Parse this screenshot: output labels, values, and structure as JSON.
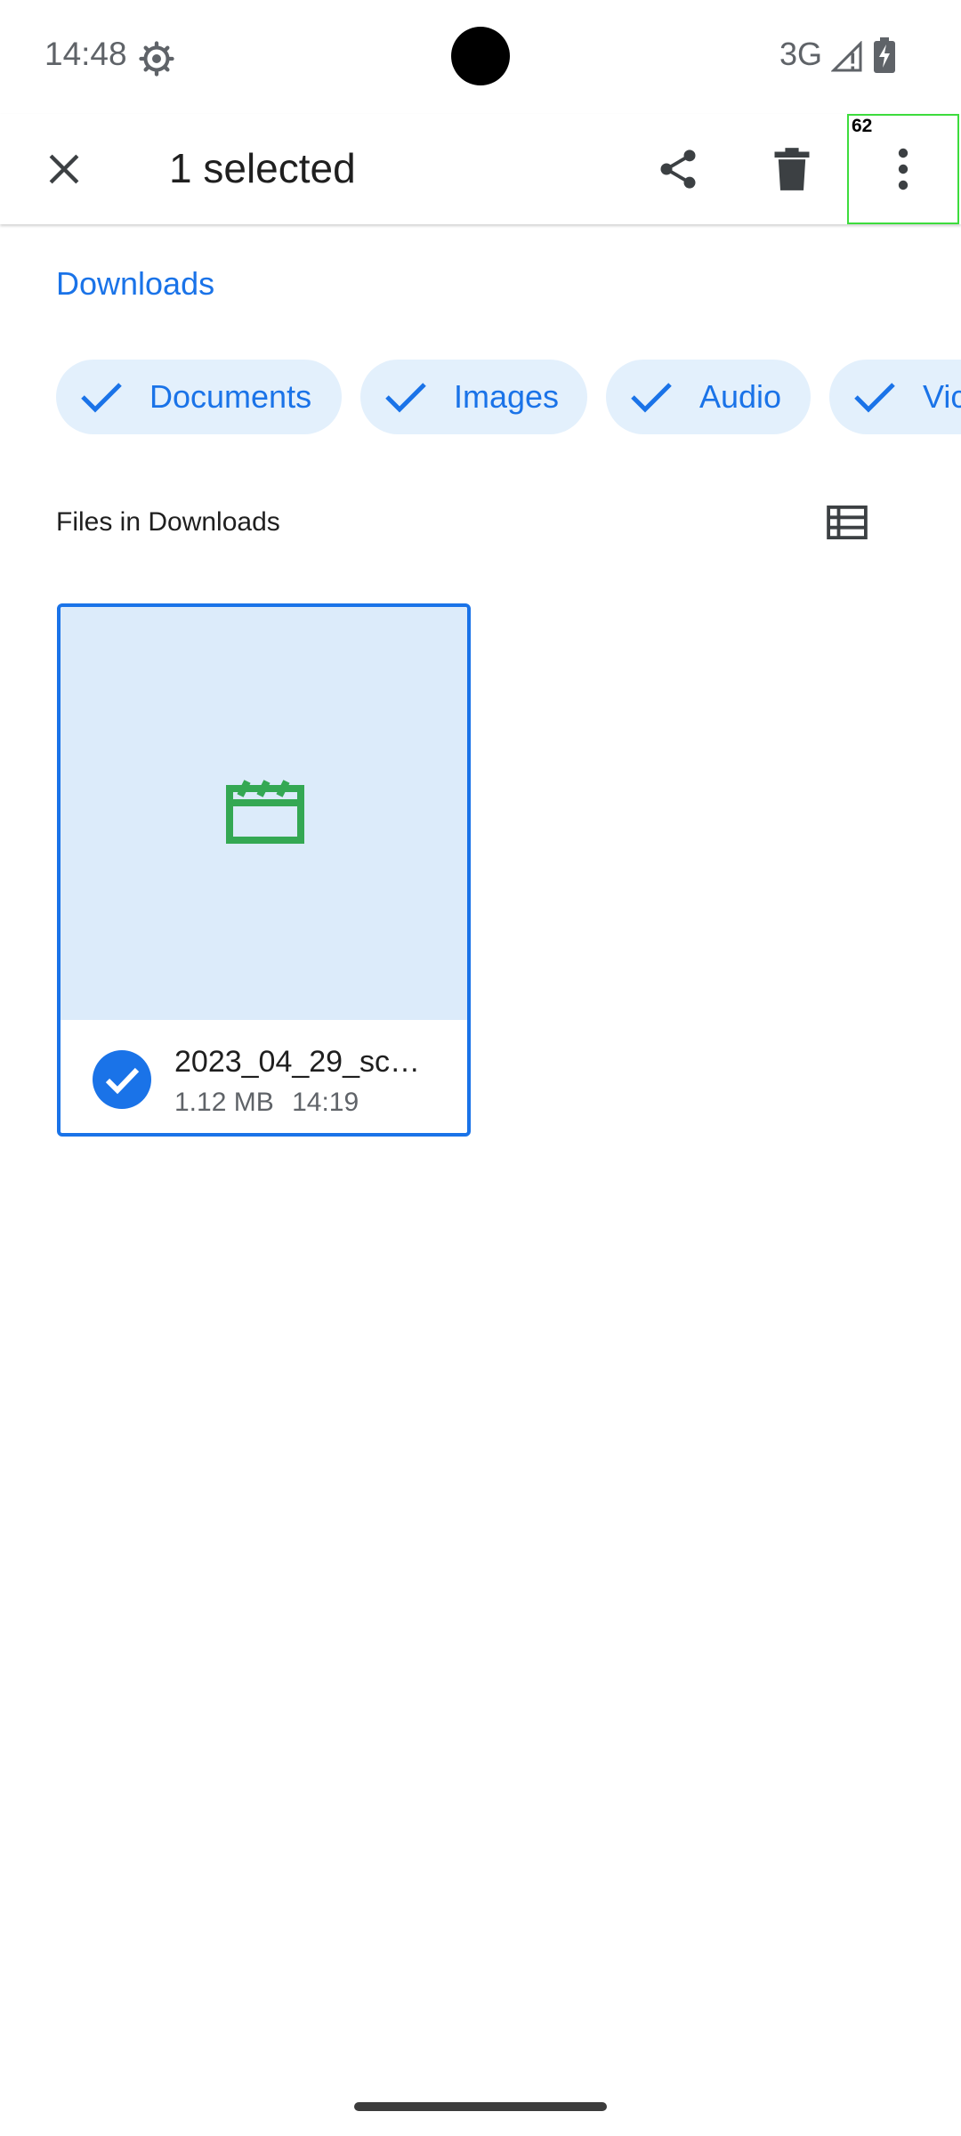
{
  "status_bar": {
    "time": "14:48",
    "settings_icon": "gear-icon",
    "network": "3G",
    "signal_icon": "signal-icon",
    "battery_icon": "battery-charging-icon"
  },
  "action_bar": {
    "close_icon": "close-icon",
    "title": "1 selected",
    "share_icon": "share-icon",
    "delete_icon": "delete-icon",
    "more_icon": "more-vert-icon",
    "more_badge": "62"
  },
  "breadcrumb": "Downloads",
  "filters": [
    {
      "label": "Documents",
      "selected": true
    },
    {
      "label": "Images",
      "selected": true
    },
    {
      "label": "Audio",
      "selected": true
    },
    {
      "label": "Vic",
      "selected": true
    }
  ],
  "section": {
    "title": "Files in Downloads",
    "view_toggle_icon": "list-view-icon"
  },
  "files": [
    {
      "name": "2023_04_29_sc…",
      "size": "1.12 MB",
      "time": "14:19",
      "type_icon": "movie-icon",
      "selected": true
    }
  ],
  "colors": {
    "accent": "#1a73e8",
    "chip_background": "#e3f0fc",
    "thumbnail_background": "#dcebfa",
    "movie_icon": "#34a853",
    "icon_dark": "#3c4043",
    "highlight_box": "#3ddc3d"
  }
}
